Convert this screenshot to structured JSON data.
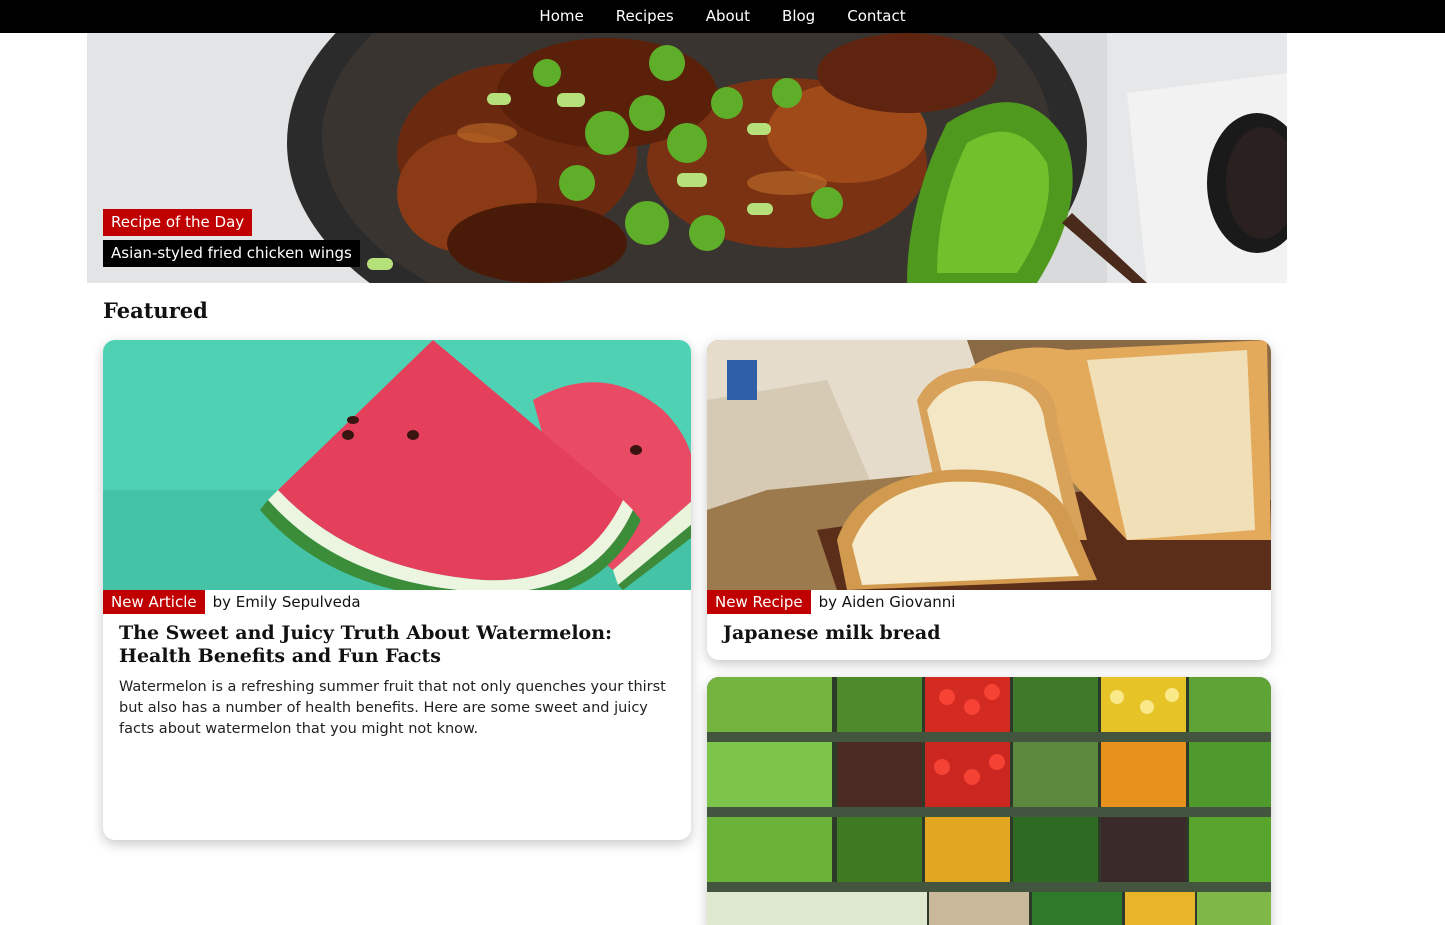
{
  "nav": {
    "items": [
      "Home",
      "Recipes",
      "About",
      "Blog",
      "Contact"
    ]
  },
  "hero": {
    "badge": "Recipe of the Day",
    "caption": "Asian-styled fried chicken wings",
    "image_icon": "chicken-wings-photo"
  },
  "featured": {
    "title": "Featured",
    "cards": [
      {
        "tag": "New Article",
        "byline": "by Emily Sepulveda",
        "title": "The Sweet and Juicy Truth About Watermelon: Health Benefits and Fun Facts",
        "text": "Watermelon is a refreshing summer fruit that not only quenches your thirst but also has a number of health benefits. Here are some sweet and juicy facts about watermelon that you might not know.",
        "image_icon": "watermelon-photo"
      },
      {
        "tag": "New Recipe",
        "byline": "by Aiden Giovanni",
        "title": "Japanese milk bread",
        "image_icon": "bread-photo"
      },
      {
        "image_icon": "vegetables-photo"
      }
    ]
  },
  "colors": {
    "nav_bg": "#000000",
    "accent_red": "#c00000",
    "caption_bg": "#000000"
  }
}
